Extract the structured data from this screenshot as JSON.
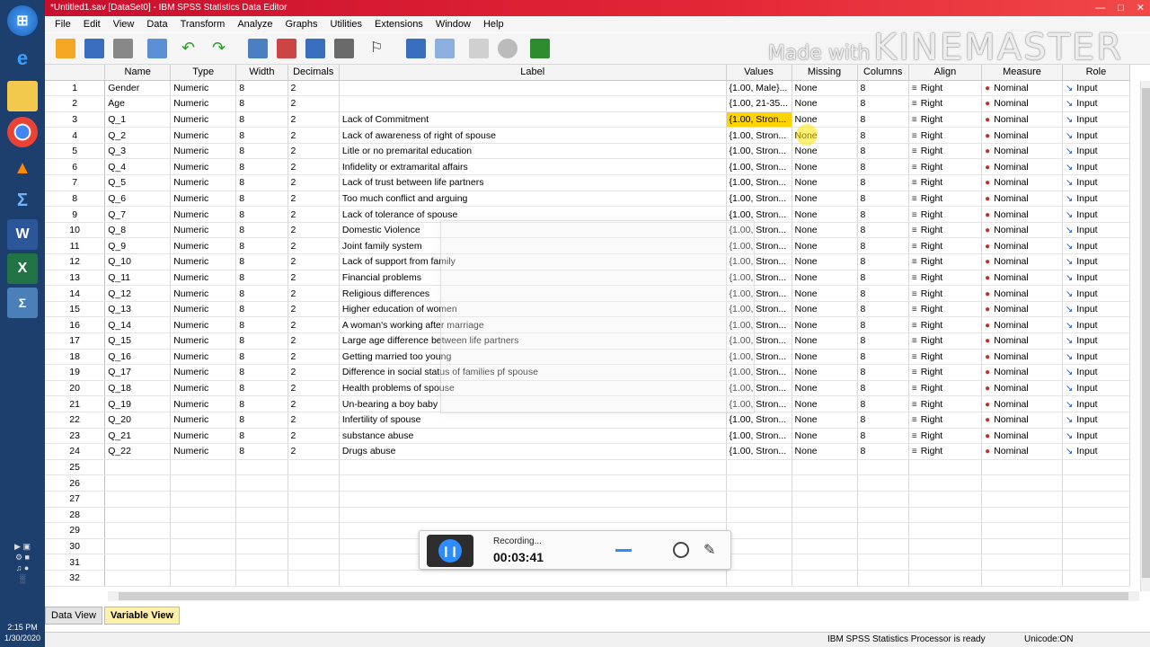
{
  "window": {
    "title": "*Untitled1.sav [DataSet0] - IBM SPSS Statistics Data Editor",
    "controls": [
      "—",
      "□",
      "✕"
    ]
  },
  "menu": [
    "File",
    "Edit",
    "View",
    "Data",
    "Transform",
    "Analyze",
    "Graphs",
    "Utilities",
    "Extensions",
    "Window",
    "Help"
  ],
  "watermark": {
    "small": "Made with",
    "big": "KINEMASTER"
  },
  "columns": [
    "",
    "Name",
    "Type",
    "Width",
    "Decimals",
    "Label",
    "Values",
    "Missing",
    "Columns",
    "Align",
    "Measure",
    "Role"
  ],
  "rows": [
    {
      "n": "1",
      "name": "Gender",
      "type": "Numeric",
      "width": "8",
      "decimals": "2",
      "label": "",
      "values": "{1.00, Male}...",
      "missing": "None",
      "columns": "8",
      "align": "Right",
      "measure": "Nominal",
      "role": "Input"
    },
    {
      "n": "2",
      "name": "Age",
      "type": "Numeric",
      "width": "8",
      "decimals": "2",
      "label": "",
      "values": "{1.00, 21-35...",
      "missing": "None",
      "columns": "8",
      "align": "Right",
      "measure": "Nominal",
      "role": "Input"
    },
    {
      "n": "3",
      "name": "Q_1",
      "type": "Numeric",
      "width": "8",
      "decimals": "2",
      "label": "Lack of Commitment",
      "values": "{1.00, Stron...",
      "missing": "None",
      "columns": "8",
      "align": "Right",
      "measure": "Nominal",
      "role": "Input"
    },
    {
      "n": "4",
      "name": "Q_2",
      "type": "Numeric",
      "width": "8",
      "decimals": "2",
      "label": "Lack of awareness of right of spouse",
      "values": "{1.00, Stron...",
      "missing": "None",
      "columns": "8",
      "align": "Right",
      "measure": "Nominal",
      "role": "Input"
    },
    {
      "n": "5",
      "name": "Q_3",
      "type": "Numeric",
      "width": "8",
      "decimals": "2",
      "label": "Litle or no premarital education",
      "values": "{1.00, Stron...",
      "missing": "None",
      "columns": "8",
      "align": "Right",
      "measure": "Nominal",
      "role": "Input"
    },
    {
      "n": "6",
      "name": "Q_4",
      "type": "Numeric",
      "width": "8",
      "decimals": "2",
      "label": "Infidelity or extramarital affairs",
      "values": "{1.00, Stron...",
      "missing": "None",
      "columns": "8",
      "align": "Right",
      "measure": "Nominal",
      "role": "Input"
    },
    {
      "n": "7",
      "name": "Q_5",
      "type": "Numeric",
      "width": "8",
      "decimals": "2",
      "label": "Lack of trust between life partners",
      "values": "{1.00, Stron...",
      "missing": "None",
      "columns": "8",
      "align": "Right",
      "measure": "Nominal",
      "role": "Input"
    },
    {
      "n": "8",
      "name": "Q_6",
      "type": "Numeric",
      "width": "8",
      "decimals": "2",
      "label": "Too much conflict and arguing",
      "values": "{1.00, Stron...",
      "missing": "None",
      "columns": "8",
      "align": "Right",
      "measure": "Nominal",
      "role": "Input"
    },
    {
      "n": "9",
      "name": "Q_7",
      "type": "Numeric",
      "width": "8",
      "decimals": "2",
      "label": "Lack of tolerance of spouse",
      "values": "{1.00, Stron...",
      "missing": "None",
      "columns": "8",
      "align": "Right",
      "measure": "Nominal",
      "role": "Input"
    },
    {
      "n": "10",
      "name": "Q_8",
      "type": "Numeric",
      "width": "8",
      "decimals": "2",
      "label": "Domestic Violence",
      "values": "{1.00, Stron...",
      "missing": "None",
      "columns": "8",
      "align": "Right",
      "measure": "Nominal",
      "role": "Input"
    },
    {
      "n": "11",
      "name": "Q_9",
      "type": "Numeric",
      "width": "8",
      "decimals": "2",
      "label": "Joint family system",
      "values": "{1.00, Stron...",
      "missing": "None",
      "columns": "8",
      "align": "Right",
      "measure": "Nominal",
      "role": "Input"
    },
    {
      "n": "12",
      "name": "Q_10",
      "type": "Numeric",
      "width": "8",
      "decimals": "2",
      "label": "Lack of support from family",
      "values": "{1.00, Stron...",
      "missing": "None",
      "columns": "8",
      "align": "Right",
      "measure": "Nominal",
      "role": "Input"
    },
    {
      "n": "13",
      "name": "Q_11",
      "type": "Numeric",
      "width": "8",
      "decimals": "2",
      "label": "Financial problems",
      "values": "{1.00, Stron...",
      "missing": "None",
      "columns": "8",
      "align": "Right",
      "measure": "Nominal",
      "role": "Input"
    },
    {
      "n": "14",
      "name": "Q_12",
      "type": "Numeric",
      "width": "8",
      "decimals": "2",
      "label": "Religious differences",
      "values": "{1.00, Stron...",
      "missing": "None",
      "columns": "8",
      "align": "Right",
      "measure": "Nominal",
      "role": "Input"
    },
    {
      "n": "15",
      "name": "Q_13",
      "type": "Numeric",
      "width": "8",
      "decimals": "2",
      "label": "Higher education of women",
      "values": "{1.00, Stron...",
      "missing": "None",
      "columns": "8",
      "align": "Right",
      "measure": "Nominal",
      "role": "Input"
    },
    {
      "n": "16",
      "name": "Q_14",
      "type": "Numeric",
      "width": "8",
      "decimals": "2",
      "label": "A woman's working after marriage",
      "values": "{1.00, Stron...",
      "missing": "None",
      "columns": "8",
      "align": "Right",
      "measure": "Nominal",
      "role": "Input"
    },
    {
      "n": "17",
      "name": "Q_15",
      "type": "Numeric",
      "width": "8",
      "decimals": "2",
      "label": "Large age difference between life partners",
      "values": "{1.00, Stron...",
      "missing": "None",
      "columns": "8",
      "align": "Right",
      "measure": "Nominal",
      "role": "Input"
    },
    {
      "n": "18",
      "name": "Q_16",
      "type": "Numeric",
      "width": "8",
      "decimals": "2",
      "label": "Getting married too young",
      "values": "{1.00, Stron...",
      "missing": "None",
      "columns": "8",
      "align": "Right",
      "measure": "Nominal",
      "role": "Input"
    },
    {
      "n": "19",
      "name": "Q_17",
      "type": "Numeric",
      "width": "8",
      "decimals": "2",
      "label": "Difference in social status of families pf spouse",
      "values": "{1.00, Stron...",
      "missing": "None",
      "columns": "8",
      "align": "Right",
      "measure": "Nominal",
      "role": "Input"
    },
    {
      "n": "20",
      "name": "Q_18",
      "type": "Numeric",
      "width": "8",
      "decimals": "2",
      "label": "Health problems of spouse",
      "values": "{1.00, Stron...",
      "missing": "None",
      "columns": "8",
      "align": "Right",
      "measure": "Nominal",
      "role": "Input"
    },
    {
      "n": "21",
      "name": "Q_19",
      "type": "Numeric",
      "width": "8",
      "decimals": "2",
      "label": "Un-bearing a boy baby",
      "values": "{1.00, Stron...",
      "missing": "None",
      "columns": "8",
      "align": "Right",
      "measure": "Nominal",
      "role": "Input"
    },
    {
      "n": "22",
      "name": "Q_20",
      "type": "Numeric",
      "width": "8",
      "decimals": "2",
      "label": "Infertility of spouse",
      "values": "{1.00, Stron...",
      "missing": "None",
      "columns": "8",
      "align": "Right",
      "measure": "Nominal",
      "role": "Input"
    },
    {
      "n": "23",
      "name": "Q_21",
      "type": "Numeric",
      "width": "8",
      "decimals": "2",
      "label": "substance abuse",
      "values": "{1.00, Stron...",
      "missing": "None",
      "columns": "8",
      "align": "Right",
      "measure": "Nominal",
      "role": "Input"
    },
    {
      "n": "24",
      "name": "Q_22",
      "type": "Numeric",
      "width": "8",
      "decimals": "2",
      "label": "Drugs abuse",
      "values": "{1.00, Stron...",
      "missing": "None",
      "columns": "8",
      "align": "Right",
      "measure": "Nominal",
      "role": "Input"
    }
  ],
  "empty_rows": [
    "25",
    "26",
    "27",
    "28",
    "29",
    "30",
    "31",
    "32"
  ],
  "selected_row": "3",
  "tabs": {
    "data_view": "Data View",
    "variable_view": "Variable View"
  },
  "status": {
    "processor": "IBM SPSS Statistics Processor is ready",
    "unicode": "Unicode:ON"
  },
  "recorder": {
    "label": "Recording...",
    "time": "00:03:41"
  },
  "clock": {
    "time": "2:15 PM",
    "date": "1/30/2020"
  },
  "colors": {
    "title_bar": "#e32636",
    "selected_cell": "#ffd400",
    "active_tab": "#fff2a8",
    "taskbar": "#1c3f6e"
  },
  "icons": [
    "folder-open-icon",
    "save-icon",
    "print-icon",
    "dialog-recall-icon",
    "undo-icon",
    "redo-icon",
    "goto-case-icon",
    "goto-variable-icon",
    "variables-icon",
    "run-descriptives-icon",
    "find-icon",
    "insert-cases-icon",
    "insert-variable-icon",
    "split-file-icon",
    "weight-cases-icon",
    "select-cases-icon",
    "value-labels-icon",
    "use-sets-icon"
  ]
}
